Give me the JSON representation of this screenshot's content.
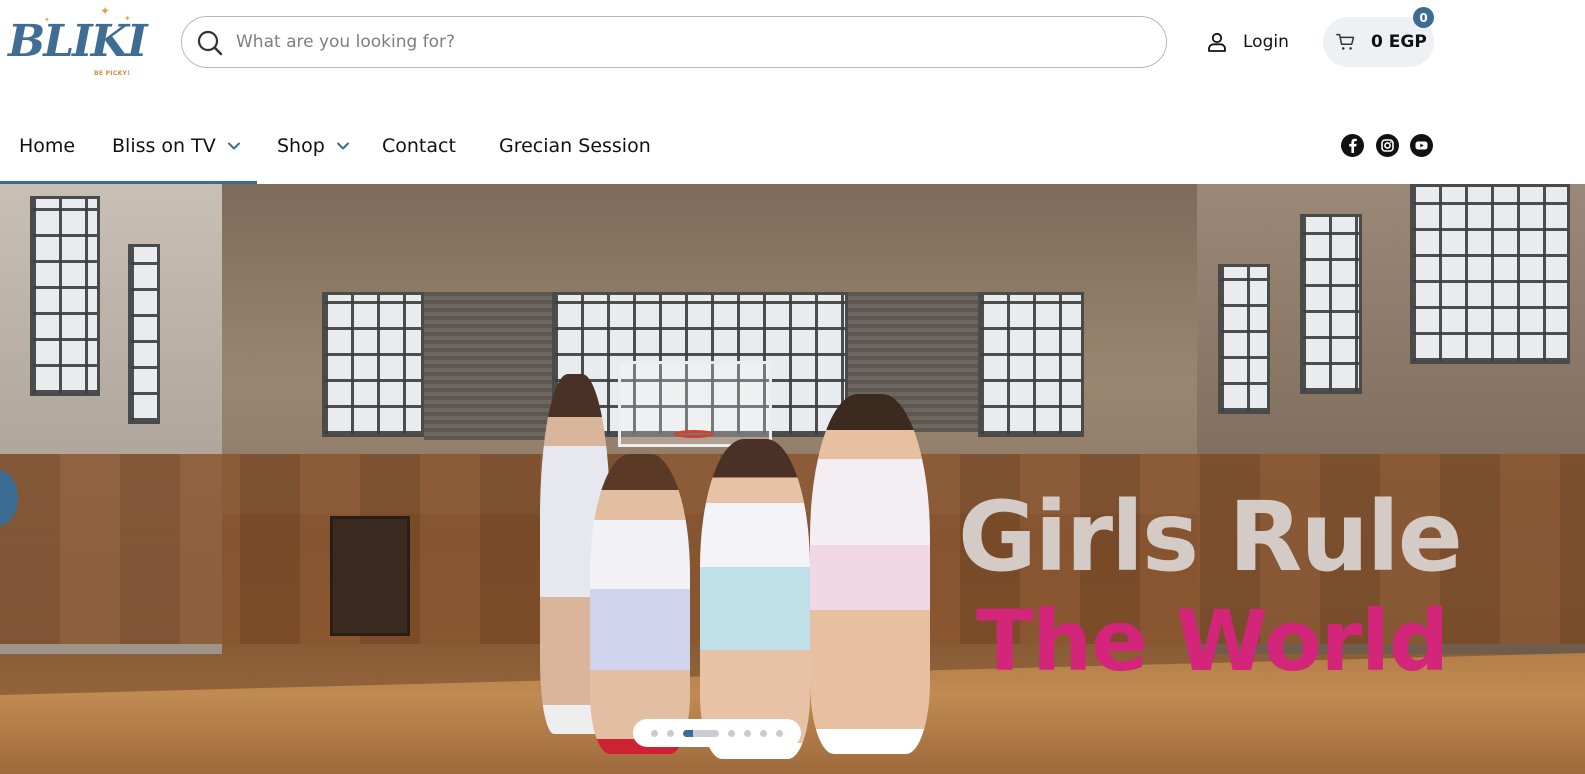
{
  "logo": {
    "name": "BLIKI",
    "tagline": "BE PICKY!"
  },
  "search": {
    "placeholder": "What are you looking for?",
    "value": ""
  },
  "account": {
    "login_label": "Login"
  },
  "cart": {
    "total": "0 EGP",
    "count": "0"
  },
  "nav": {
    "items": [
      {
        "label": "Home"
      },
      {
        "label": "Bliss on TV",
        "has_dropdown": true
      },
      {
        "label": "Shop",
        "has_dropdown": true
      },
      {
        "label": "Contact"
      },
      {
        "label": "Grecian Session"
      }
    ]
  },
  "social": [
    "facebook-icon",
    "instagram-icon",
    "youtube-icon"
  ],
  "hero": {
    "headline": "Girls Rule",
    "subline": "The World",
    "headline_color": "#d4cbc6",
    "subline_color": "#d3257a",
    "slide_count": 7,
    "active_slide": 2
  },
  "colors": {
    "accent": "#3b6d94"
  }
}
